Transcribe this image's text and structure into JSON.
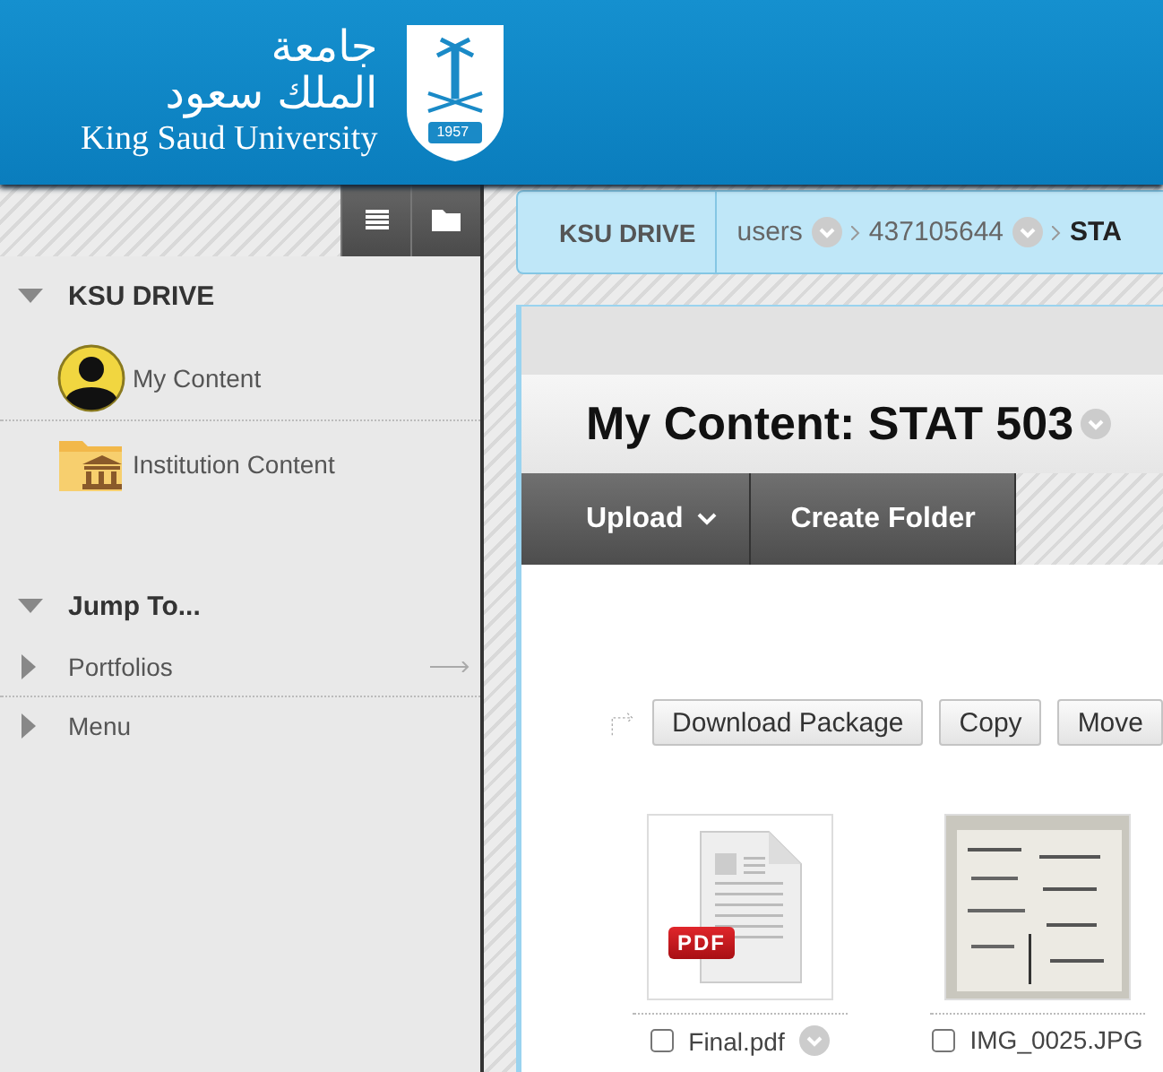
{
  "header": {
    "logo_arabic_line_1": "جامعة",
    "logo_arabic_line_2": "الملك سعود",
    "logo_english": "King Saud University",
    "emblem_year": "1957"
  },
  "sidebar": {
    "view_buttons": [
      {
        "kind": "list"
      },
      {
        "kind": "folder"
      }
    ],
    "sections": [
      {
        "title": "KSU DRIVE",
        "expanded": true,
        "items": [
          {
            "label": "My Content",
            "kind": "user"
          },
          {
            "label": "Institution Content",
            "kind": "institution"
          }
        ]
      },
      {
        "title": "Jump To...",
        "expanded": true,
        "items": [
          {
            "label": "Portfolios",
            "kind": "expandable",
            "expanded": false,
            "go_arrow": true
          },
          {
            "label": "Menu",
            "kind": "expandable",
            "expanded": false,
            "go_arrow": false
          }
        ]
      }
    ]
  },
  "breadcrumb": {
    "root": "KSU DRIVE",
    "crumbs": [
      {
        "label": "users",
        "menu": true,
        "current": false
      },
      {
        "label": "437105644",
        "menu": true,
        "current": false
      },
      {
        "label": "STA",
        "menu": false,
        "current": true
      }
    ]
  },
  "title": "My Content: STAT 503",
  "toolbar": [
    {
      "label": "Upload",
      "dropdown": true
    },
    {
      "label": "Create Folder",
      "dropdown": false
    }
  ],
  "actions": [
    "Download Package",
    "Copy",
    "Move"
  ],
  "files": [
    {
      "name": "Final.pdf",
      "kind": "pdf",
      "badge": "PDF",
      "checked": false,
      "menu": true
    },
    {
      "name": "IMG_0025.JPG",
      "kind": "picture",
      "checked": false,
      "menu": false
    }
  ]
}
